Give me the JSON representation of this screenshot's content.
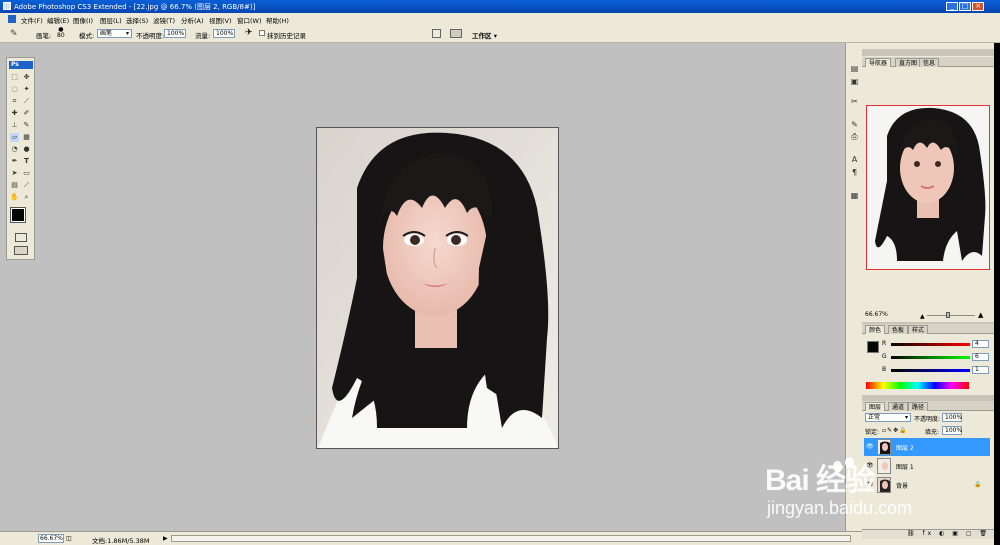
{
  "window": {
    "title": "Adobe Photoshop CS3 Extended - [22.jpg @ 66.7% (图层 2, RGB/8#)]",
    "minimize": "_",
    "maximize": "□",
    "close": "×"
  },
  "menu": [
    "文件(F)",
    "编辑(E)",
    "图像(I)",
    "图层(L)",
    "选择(S)",
    "滤镜(T)",
    "分析(A)",
    "视图(V)",
    "窗口(W)",
    "帮助(H)"
  ],
  "options": {
    "brush_label": "画笔:",
    "brush_size": "80",
    "mode_label": "模式:",
    "mode_value": "画笔",
    "opacity_label": "不透明度:",
    "opacity_value": "100%",
    "flow_label": "流量:",
    "flow_value": "100%",
    "history_label": "抹到历史记录",
    "workspace_label": "工作区 ▾"
  },
  "toolbox": {
    "logo": "Ps"
  },
  "status": {
    "zoom": "66.67%",
    "doc": "文档:1.86M/5.38M"
  },
  "navigator": {
    "tabs": [
      "导航器",
      "直方图",
      "信息"
    ],
    "zoom": "66.67%"
  },
  "color_panel": {
    "tabs": [
      "颜色",
      "色板",
      "样式"
    ],
    "channels": [
      {
        "label": "R",
        "value": "4"
      },
      {
        "label": "G",
        "value": "6"
      },
      {
        "label": "B",
        "value": "1"
      }
    ],
    "foreground": "#040601"
  },
  "layers_panel": {
    "tabs": [
      "图层",
      "通道",
      "路径"
    ],
    "blend_mode": "正常",
    "opacity_label": "不透明度:",
    "opacity_value": "100%",
    "lock_label": "锁定:",
    "fill_label": "填充:",
    "fill_value": "100%",
    "layers": [
      {
        "name": "图层 2",
        "selected": true
      },
      {
        "name": "图层 1",
        "selected": false
      },
      {
        "name": "背景",
        "selected": false
      }
    ]
  },
  "watermark": {
    "brand": "Bai 经验",
    "url": "jingyan.baidu.com"
  },
  "colors": {
    "accent": "#3399ff",
    "title_blue": "#0a5fd6",
    "workspace_gray": "#c0c0c0"
  }
}
